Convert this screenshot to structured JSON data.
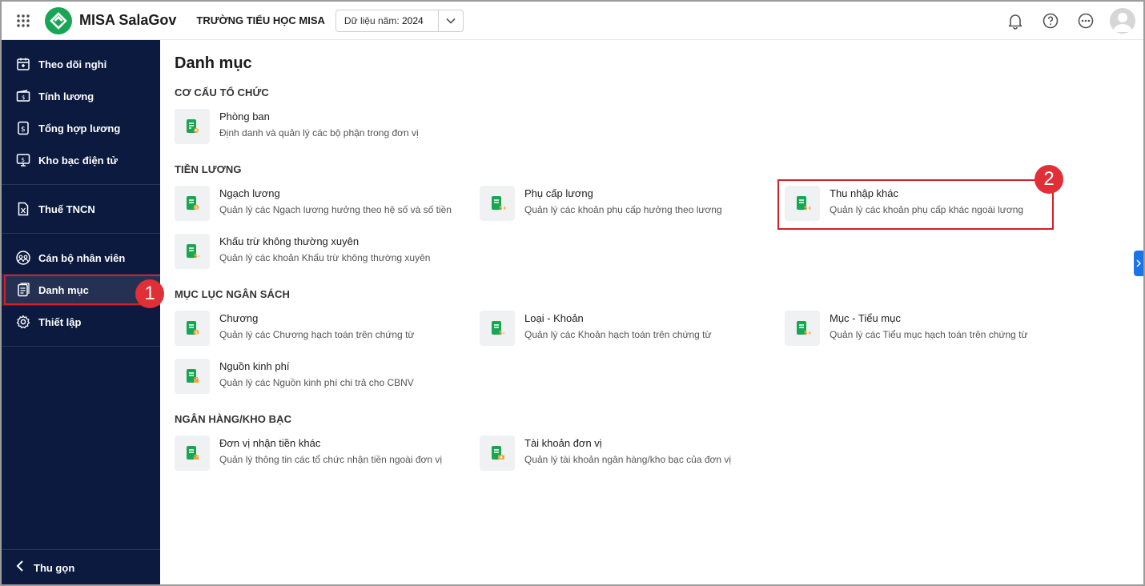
{
  "header": {
    "app_name": "MISA SalaGov",
    "org_name": "TRƯỜNG TIỂU HỌC MISA",
    "year_label": "Dữ liệu năm:",
    "year_value": "2024",
    "icons": [
      "apps-grid-icon",
      "notification-bell-icon",
      "help-icon",
      "more-icon",
      "avatar"
    ]
  },
  "sidebar": {
    "groups": [
      [
        {
          "label": "Theo dõi nghỉ",
          "icon": "calendar-icon"
        },
        {
          "label": "Tính lương",
          "icon": "money-icon"
        },
        {
          "label": "Tổng hợp lương",
          "icon": "salary-doc-icon"
        },
        {
          "label": "Kho bạc điện tử",
          "icon": "treasury-icon"
        }
      ],
      [
        {
          "label": "Thuế TNCN",
          "icon": "tax-icon"
        }
      ],
      [
        {
          "label": "Cán bộ nhân viên",
          "icon": "staff-icon"
        },
        {
          "label": "Danh mục",
          "icon": "catalog-icon",
          "active": true
        },
        {
          "label": "Thiết lập",
          "icon": "settings-icon"
        }
      ]
    ],
    "collapse_label": "Thu gọn"
  },
  "main": {
    "title": "Danh mục",
    "sections": [
      {
        "title": "CƠ CẤU TỔ CHỨC",
        "items": [
          {
            "title": "Phòng ban",
            "desc": "Định danh và quản lý các bộ phận trong đơn vị"
          }
        ]
      },
      {
        "title": "TIỀN LƯƠNG",
        "items": [
          {
            "title": "Ngạch lương",
            "desc": "Quản lý các Ngạch lương hưởng theo hệ số và số tiền"
          },
          {
            "title": "Phụ cấp lương",
            "desc": "Quản lý các khoản phụ cấp hưởng theo lương"
          },
          {
            "title": "Thu nhập khác",
            "desc": "Quản lý các khoản phụ cấp khác ngoài lương"
          },
          {
            "title": "Khấu trừ không thường xuyên",
            "desc": "Quản lý các khoản Khấu trừ không thường xuyên"
          }
        ]
      },
      {
        "title": "MỤC LỤC NGÂN SÁCH",
        "items": [
          {
            "title": "Chương",
            "desc": "Quản lý các Chương hạch toán trên chứng từ"
          },
          {
            "title": "Loại - Khoản",
            "desc": "Quản lý các Khoản hạch toán trên chứng từ"
          },
          {
            "title": "Mục - Tiểu mục",
            "desc": "Quản lý các Tiểu mục hạch toán trên chứng từ"
          },
          {
            "title": "Nguồn kinh phí",
            "desc": "Quản lý các Nguồn kinh phí chi trả cho CBNV"
          }
        ]
      },
      {
        "title": "NGÂN HÀNG/KHO BẠC",
        "items": [
          {
            "title": "Đơn vị nhận tiền khác",
            "desc": "Quản lý thông tin các tổ chức nhận tiền ngoài đơn vị"
          },
          {
            "title": "Tài khoản đơn vị",
            "desc": "Quản lý tài khoản ngân hàng/kho bạc của đơn vị"
          }
        ]
      }
    ]
  },
  "annotations": {
    "step1": "1",
    "step2": "2"
  },
  "colors": {
    "sidebar_bg": "#0c1a3f",
    "brand_green": "#19a654",
    "highlight_red": "#d32027",
    "badge_red": "#e02f36"
  }
}
